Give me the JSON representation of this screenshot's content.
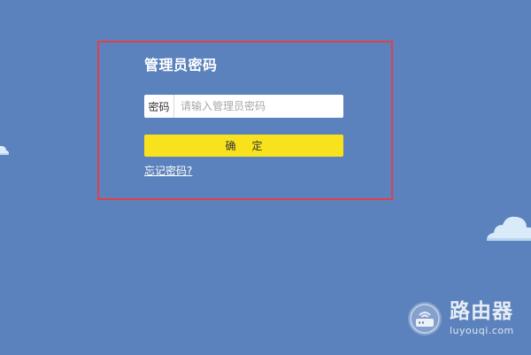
{
  "login": {
    "title": "管理员密码",
    "password_label": "密码",
    "password_placeholder": "请输入管理员密码",
    "password_value": "",
    "confirm_label": "确定",
    "forgot_label": "忘记密码?"
  },
  "watermark": {
    "title": "路由器",
    "url": "luyouqi.com"
  },
  "colors": {
    "background": "#5b82bd",
    "highlight_border": "#e0404a",
    "button": "#f7e21d"
  },
  "icons": [
    "cloud-icon",
    "router-logo-icon"
  ]
}
